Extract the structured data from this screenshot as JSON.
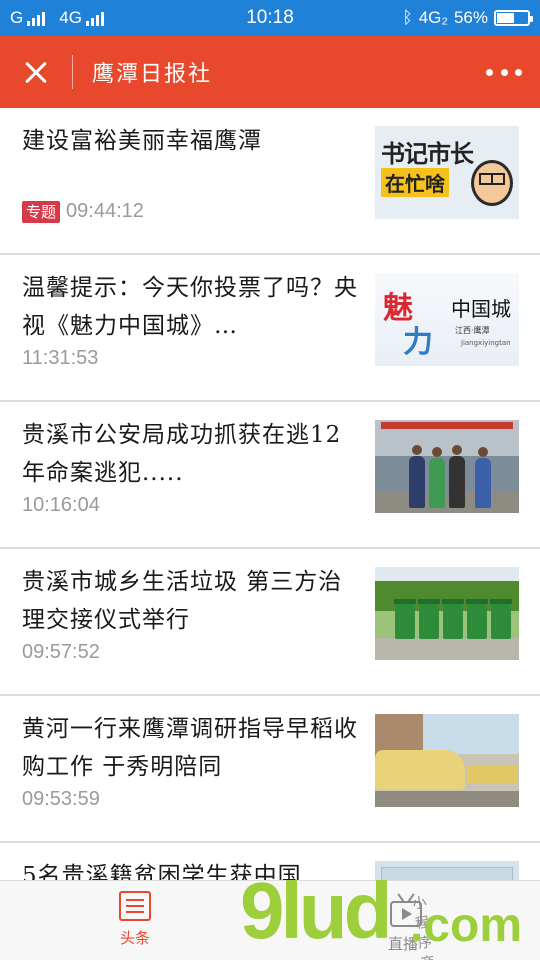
{
  "status_bar": {
    "carrier_1": "G",
    "carrier_2": "4G",
    "time": "10:18",
    "network": "4G₂",
    "battery_percent": "56%",
    "battery_level": 0.56
  },
  "header": {
    "title": "鹰潭日报社",
    "background_color": "#e8482c"
  },
  "news": [
    {
      "headline": "建设富裕美丽幸福鹰潭",
      "tag": "专题",
      "time": "09:44:12",
      "thumb_text_1": "书记市长",
      "thumb_text_2": "在忙啥"
    },
    {
      "headline": "温馨提示：今天你投票了吗？央视《魅力中国城》…",
      "tag": "",
      "time": "11:31:53",
      "thumb_text_1": "魅",
      "thumb_text_2": "力",
      "thumb_text_3": "中国城",
      "thumb_text_4": "江西·鹰潭",
      "thumb_text_5": "jiangxiyingtan"
    },
    {
      "headline": "贵溪市公安局成功抓获在逃12年命案逃犯.....",
      "tag": "",
      "time": "10:16:04"
    },
    {
      "headline": "贵溪市城乡生活垃圾 第三方治理交接仪式举行",
      "tag": "",
      "time": "09:57:52"
    },
    {
      "headline": "黄河一行来鹰潭调研指导早稻收购工作 于秀明陪同",
      "tag": "",
      "time": "09:53:59"
    },
    {
      "headline": "5名贵溪籍贫困学生获中国",
      "tag": "",
      "time": ""
    }
  ],
  "bottom_nav": {
    "headlines_label": "头条",
    "live_label": "直播",
    "active_color": "#e8482c"
  },
  "watermark": {
    "brand": "9lud",
    "domain": ".com",
    "store_text": "小程序商店"
  }
}
